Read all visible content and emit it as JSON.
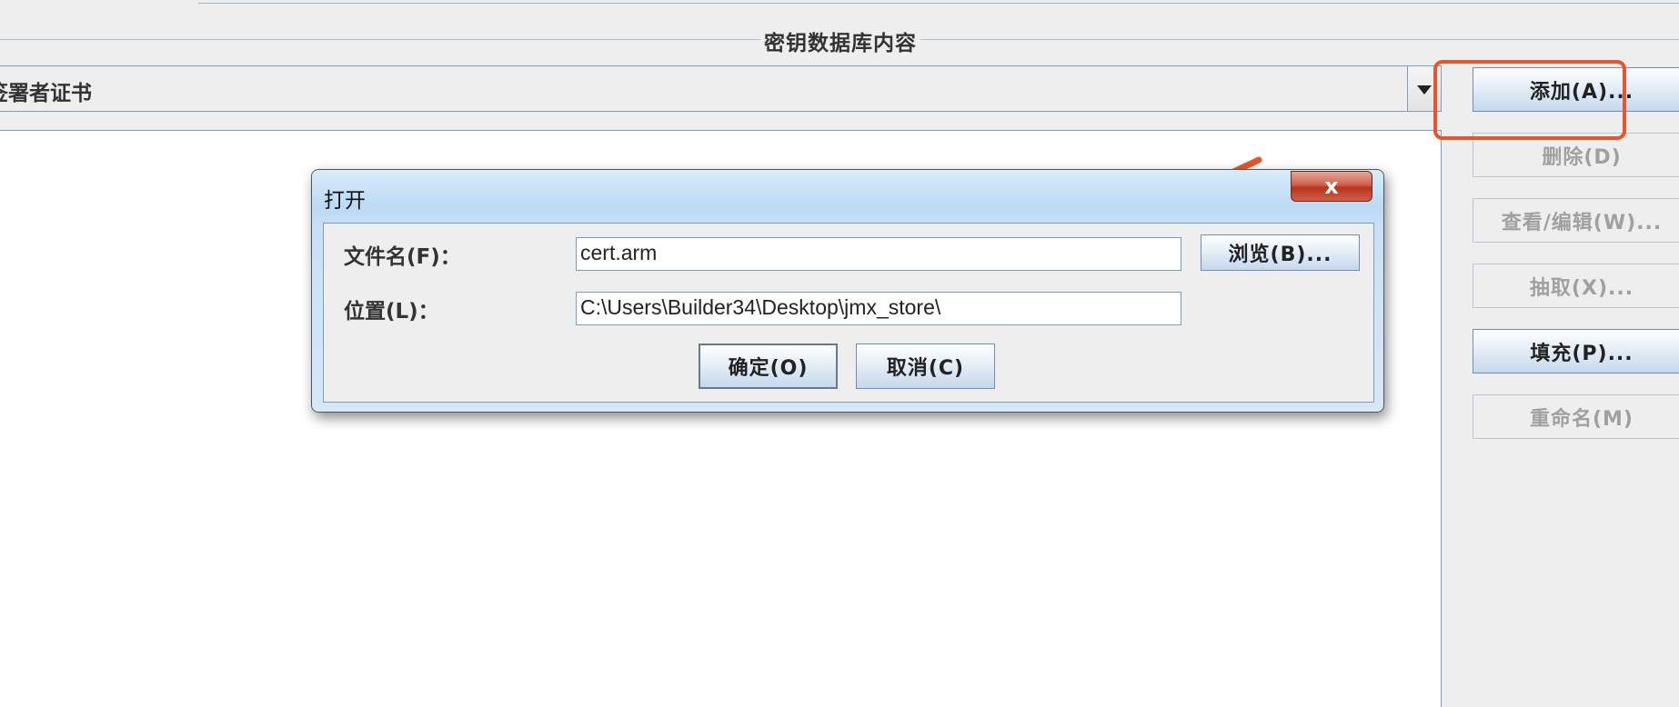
{
  "group": {
    "title": "密钥数据库内容"
  },
  "combo": {
    "selected_label": "签署者证书"
  },
  "side_buttons": [
    {
      "label": "添加(A)...",
      "enabled": true
    },
    {
      "label": "删除(D)",
      "enabled": false
    },
    {
      "label": "查看/编辑(W)...",
      "enabled": false
    },
    {
      "label": "抽取(X)...",
      "enabled": false
    },
    {
      "label": "填充(P)...",
      "enabled": true
    },
    {
      "label": "重命名(M)",
      "enabled": false
    }
  ],
  "dialog": {
    "title": "打开",
    "close_label": "x",
    "file_name_label": "文件名(F)：",
    "file_name_value": "cert.arm",
    "location_label": "位置(L)：",
    "location_value": "C:\\Users\\Builder34\\Desktop\\jmx_store\\",
    "browse_label": "浏览(B)...",
    "ok_label": "确定(O)",
    "cancel_label": "取消(C)"
  },
  "colors": {
    "highlight": "#e8542b",
    "background": "#eeeeee",
    "border": "#7f9db9"
  }
}
